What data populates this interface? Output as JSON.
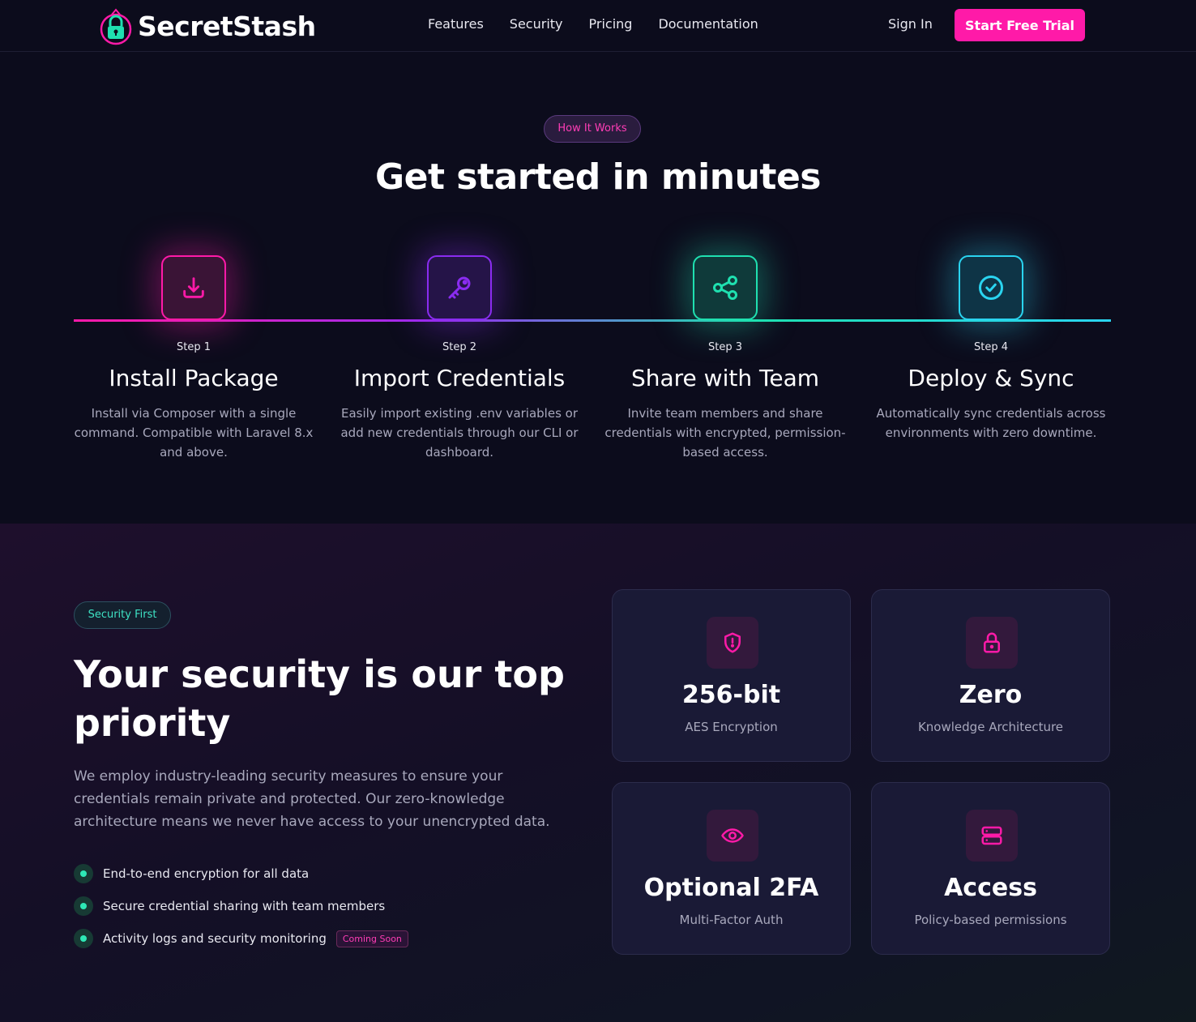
{
  "nav": {
    "logo_text": "SecretStash",
    "links": [
      "Features",
      "Security",
      "Pricing",
      "Documentation"
    ],
    "sign_in": "Sign In",
    "cta": "Start Free Trial"
  },
  "how_it_works": {
    "badge": "How It Works",
    "title": "Get started in minutes",
    "steps": [
      {
        "num": "Step 1",
        "title": "Install Package",
        "desc": "Install via Composer with a single command. Compatible with Laravel 8.x and above.",
        "icon": "download-icon"
      },
      {
        "num": "Step 2",
        "title": "Import Credentials",
        "desc": "Easily import existing .env variables or add new credentials through our CLI or dashboard.",
        "icon": "key-icon"
      },
      {
        "num": "Step 3",
        "title": "Share with Team",
        "desc": "Invite team members and share credentials with encrypted, permission-based access.",
        "icon": "share-icon"
      },
      {
        "num": "Step 4",
        "title": "Deploy & Sync",
        "desc": "Automatically sync credentials across environments with zero downtime.",
        "icon": "check-circle-icon"
      }
    ]
  },
  "security": {
    "badge": "Security First",
    "title": "Your security is our top priority",
    "desc": "We employ industry-leading security measures to ensure your credentials remain private and protected. Our zero-knowledge architecture means we never have access to your unencrypted data.",
    "features": [
      {
        "text": "End-to-end encryption for all data"
      },
      {
        "text": "Secure credential sharing with team members"
      },
      {
        "text": "Activity logs and security monitoring",
        "badge": "Coming Soon"
      }
    ],
    "cards": [
      {
        "title": "256-bit",
        "sub": "AES Encryption",
        "icon": "shield-alert-icon"
      },
      {
        "title": "Zero",
        "sub": "Knowledge Architecture",
        "icon": "lock-icon"
      },
      {
        "title": "Optional 2FA",
        "sub": "Multi-Factor Auth",
        "icon": "eye-icon"
      },
      {
        "title": "Access",
        "sub": "Policy-based permissions",
        "icon": "server-icon"
      }
    ]
  },
  "colors": {
    "accent_pink": "#ff1aa8",
    "accent_purple": "#8a2cf0",
    "accent_green": "#1fe0b0",
    "accent_cyan": "#2ad4f0",
    "background": "#0c0c1c"
  }
}
